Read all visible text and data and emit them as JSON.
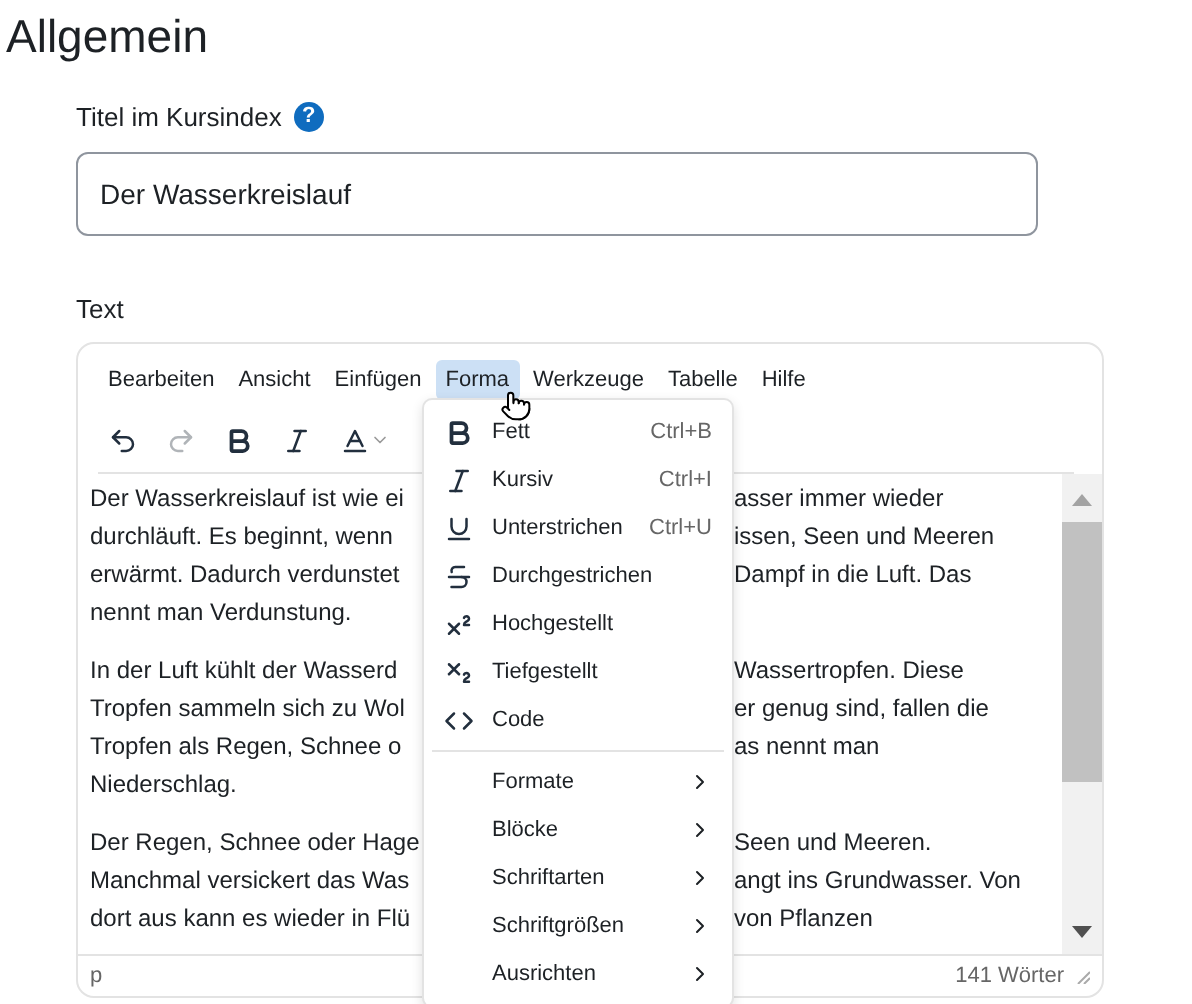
{
  "heading": "Allgemein",
  "title_field": {
    "label": "Titel im Kursindex",
    "help": "?",
    "value": "Der Wasserkreislauf"
  },
  "editor": {
    "label": "Text",
    "menubar": [
      {
        "label": "Bearbeiten",
        "selected": false
      },
      {
        "label": "Ansicht",
        "selected": false
      },
      {
        "label": "Einfügen",
        "selected": false
      },
      {
        "label": "Forma",
        "selected": true
      },
      {
        "label": "Werkzeuge",
        "selected": false
      },
      {
        "label": "Tabelle",
        "selected": false
      },
      {
        "label": "Hilfe",
        "selected": false
      }
    ],
    "toolbar": [
      {
        "kind": "undo",
        "disabled": false
      },
      {
        "kind": "redo",
        "disabled": true
      },
      {
        "kind": "bold",
        "disabled": false
      },
      {
        "kind": "italic",
        "disabled": false
      },
      {
        "kind": "text-color",
        "disabled": false
      }
    ],
    "paragraphs": [
      [
        {
          "left": "Der Wasserkreislauf ist wie ei",
          "right": "asser immer wieder"
        },
        {
          "left": "durchläuft. Es beginnt, wenn",
          "right": "issen, Seen und Meeren"
        },
        {
          "left": "erwärmt. Dadurch verdunstet",
          "right": "Dampf in die Luft. Das"
        },
        {
          "left": "nennt man Verdunstung."
        }
      ],
      [
        {
          "left": "In der Luft kühlt der Wasserd",
          "right": "Wassertropfen. Diese"
        },
        {
          "left": "Tropfen sammeln sich zu Wol",
          "right": "er genug sind, fallen die"
        },
        {
          "left": "Tropfen als Regen, Schnee o",
          "right": "as nennt man"
        },
        {
          "left": "Niederschlag."
        }
      ],
      [
        {
          "left": "Der Regen, Schnee oder Hage",
          "right": "Seen und Meeren."
        },
        {
          "left": "Manchmal versickert das Was",
          "right": "angt ins Grundwasser. Von"
        },
        {
          "left": "dort aus kann es wieder in Flü",
          "right": "von Pflanzen"
        }
      ]
    ],
    "status_path": "p",
    "word_count": "141 Wörter"
  },
  "format_menu": {
    "items": [
      {
        "kind": "bold",
        "label": "Fett",
        "shortcut": "Ctrl+B"
      },
      {
        "kind": "italic",
        "label": "Kursiv",
        "shortcut": "Ctrl+I"
      },
      {
        "kind": "underline",
        "label": "Unterstrichen",
        "shortcut": "Ctrl+U"
      },
      {
        "kind": "strikethrough",
        "label": "Durchgestrichen"
      },
      {
        "kind": "superscript",
        "label": "Hochgestellt"
      },
      {
        "kind": "subscript",
        "label": "Tiefgestellt"
      },
      {
        "kind": "code",
        "label": "Code"
      },
      {
        "kind": "divider"
      },
      {
        "kind": "submenu",
        "label": "Formate"
      },
      {
        "kind": "submenu",
        "label": "Blöcke"
      },
      {
        "kind": "submenu",
        "label": "Schriftarten"
      },
      {
        "kind": "submenu",
        "label": "Schriftgrößen"
      },
      {
        "kind": "submenu",
        "label": "Ausrichten"
      }
    ]
  }
}
